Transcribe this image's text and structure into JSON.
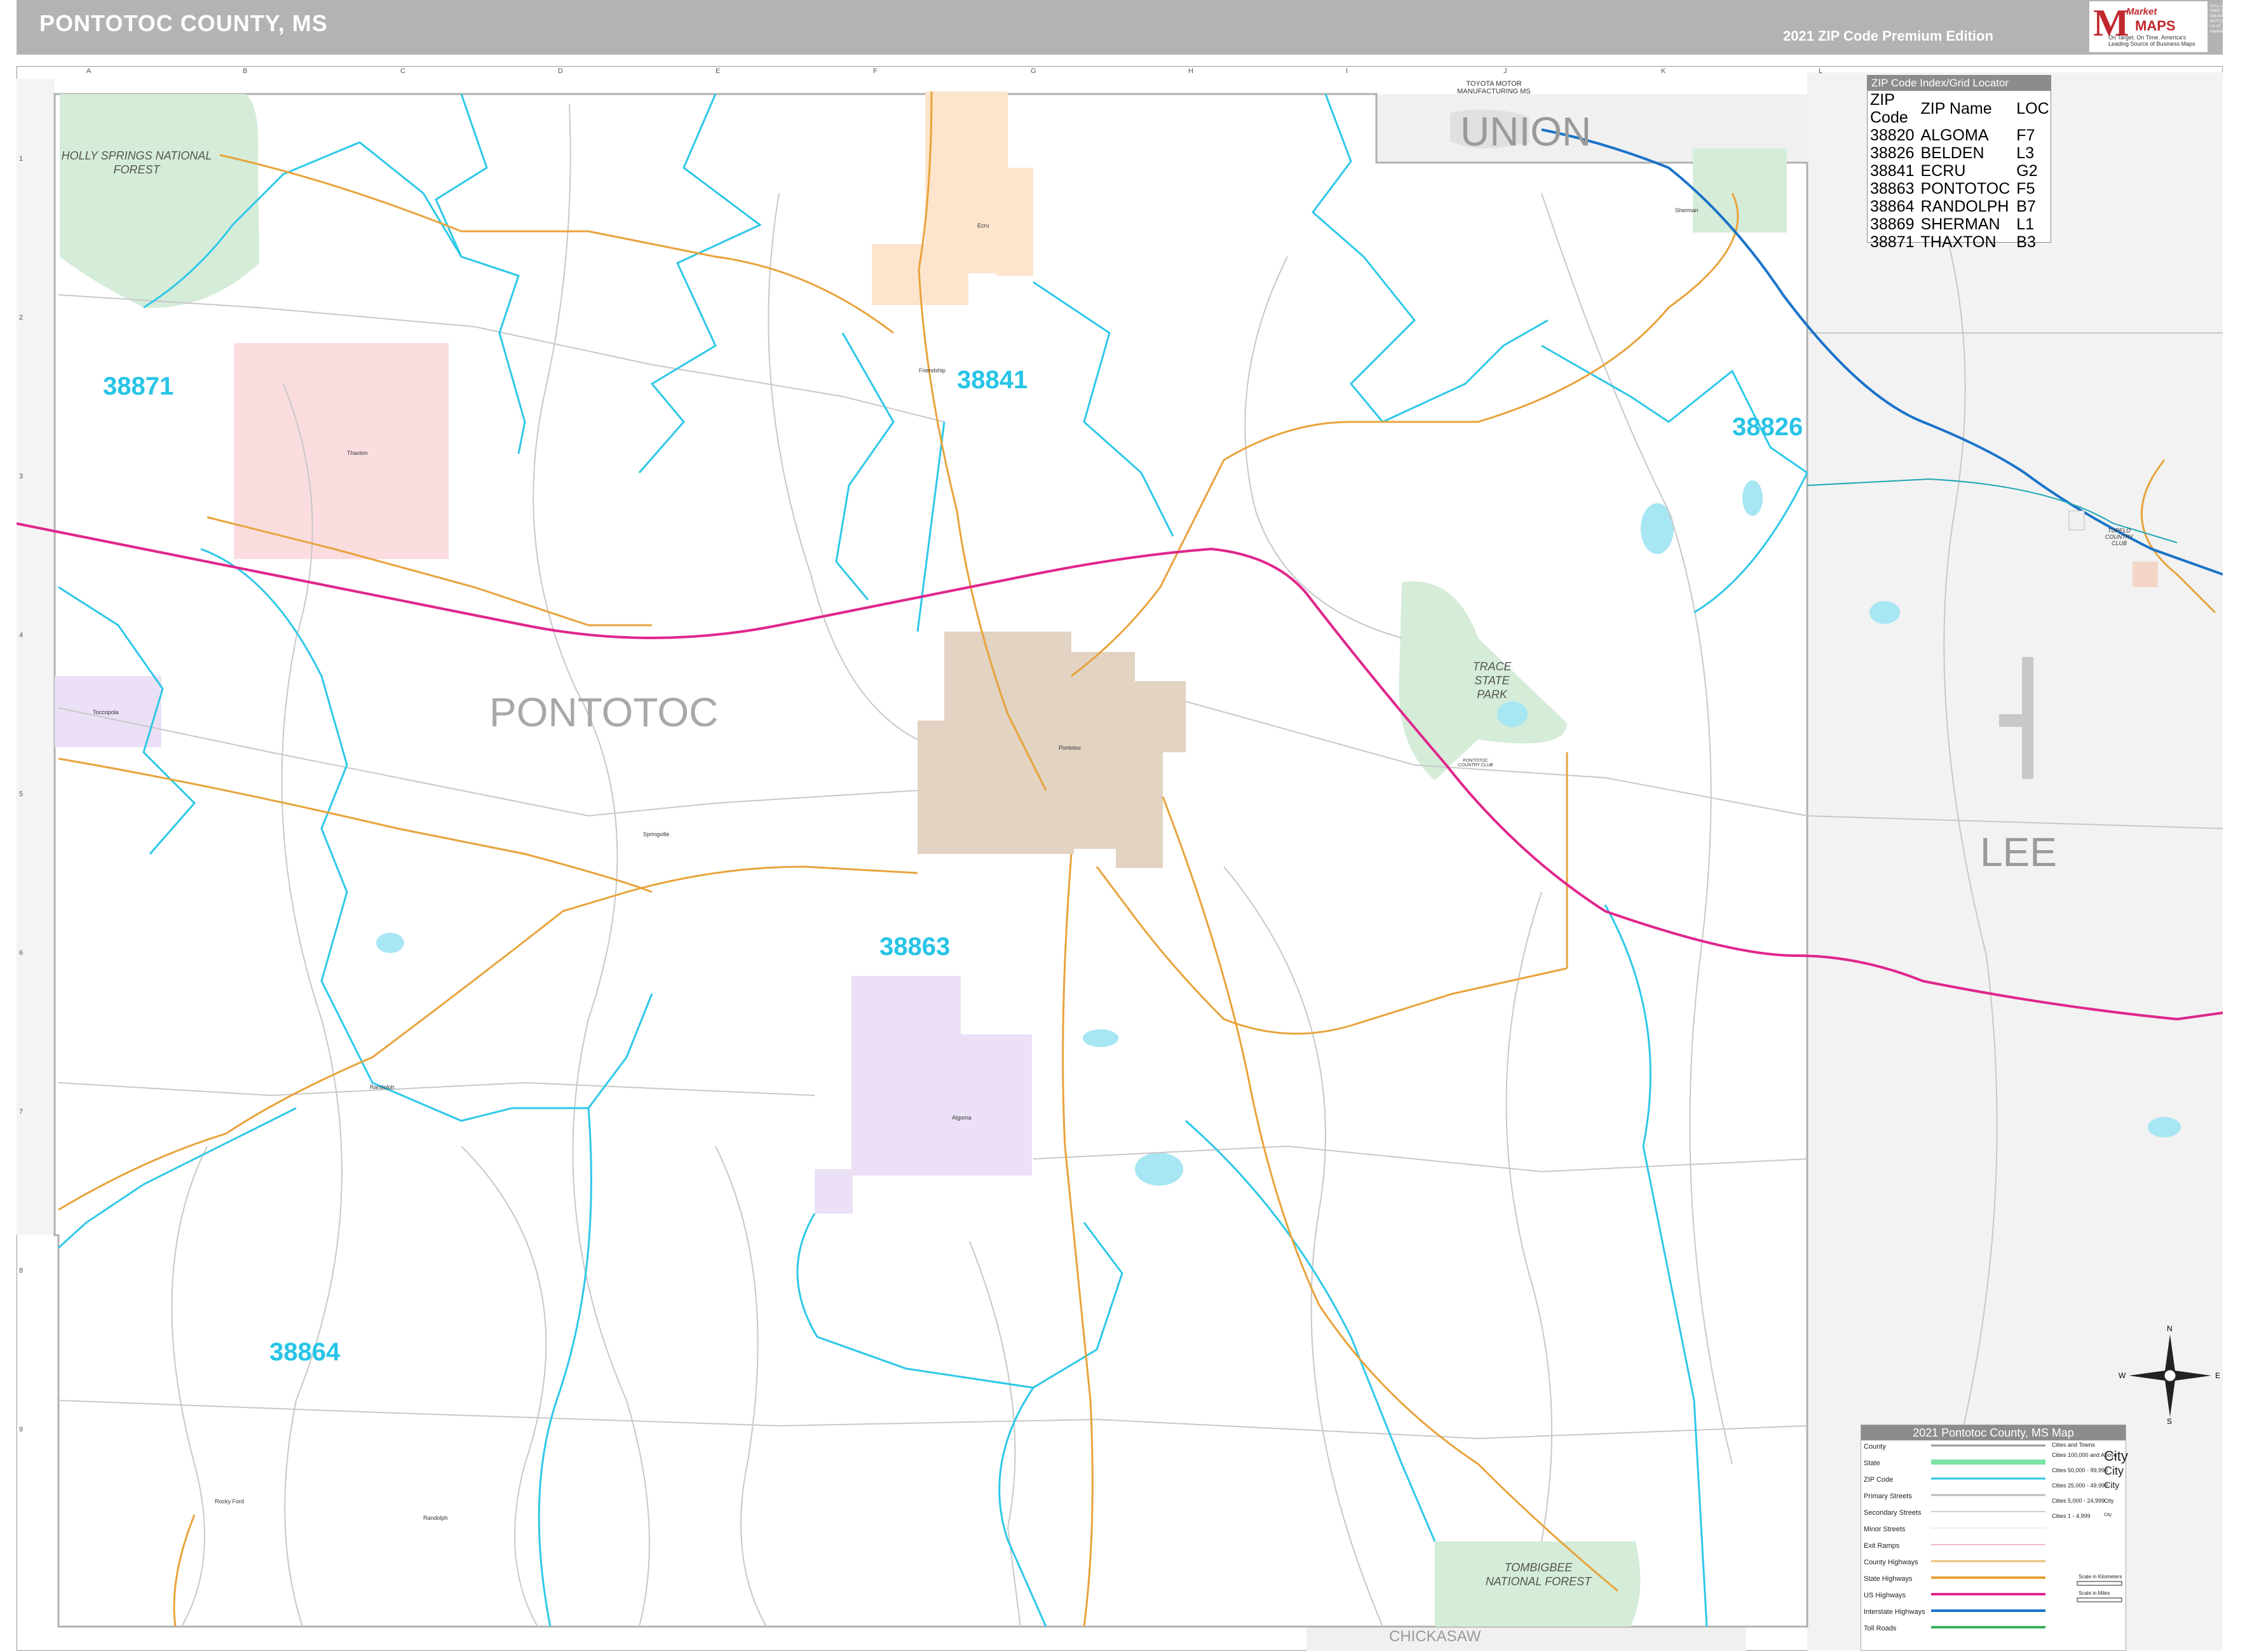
{
  "header": {
    "title": "PONTOTOC COUNTY, MS",
    "edition": "2021 ZIP Code Premium Edition",
    "brand_market": "Market",
    "brand_maps": "MAPS",
    "brand_tagline": "On Target. On Time. America's Leading Source of Business Maps",
    "contact": "CALL US TOLL FREE 1-800-334-MAPS (6277) EMAIL US AT mapsales@marketmaps.com"
  },
  "map": {
    "county_name": "PONTOTOC",
    "neighbors": {
      "north": "UNION",
      "east": "LEE",
      "south": "CHICKASAW"
    },
    "places": {
      "forest_north": "HOLLY SPRINGS NATIONAL FOREST",
      "forest_south": "TOMBIGBEE NATIONAL FOREST",
      "park": "TRACE STATE PARK",
      "toyota": "TOYOTA MOTOR MANUFACTURING MS",
      "tupelo_club": "TUPELO COUNTRY CLUB",
      "pontotoc_club": "PONTOTOC COUNTRY CLUB"
    },
    "zip_labels": [
      {
        "zip": "38871"
      },
      {
        "zip": "38841"
      },
      {
        "zip": "38826"
      },
      {
        "zip": "38863"
      },
      {
        "zip": "38864"
      }
    ],
    "towns": [
      "Ecru",
      "Thaxton",
      "Pontotoc",
      "Algoma",
      "Randolph",
      "Sherman",
      "Toccopola",
      "Springville",
      "Randolph",
      "Friendship",
      "Rocky Ford"
    ],
    "grid_cols": [
      "A",
      "B",
      "C",
      "D",
      "E",
      "F",
      "G",
      "H",
      "I",
      "J",
      "K",
      "L"
    ],
    "grid_rows": [
      "1",
      "2",
      "3",
      "4",
      "5",
      "6",
      "7",
      "8",
      "9"
    ],
    "colors": {
      "zip_boundary": "#2ec8e8",
      "us_highway": "#e0268c",
      "interstate": "#1a73c9",
      "state_highway": "#e8a33b",
      "primary_street": "#bdbdbd",
      "forest": "#d5ecd9",
      "neighbor_fill": "#f0f0f0"
    }
  },
  "zip_index": {
    "title": "ZIP Code Index/Grid Locator",
    "headers": [
      "ZIP Code",
      "ZIP Name",
      "LOC"
    ],
    "rows": [
      [
        "38820",
        "ALGOMA",
        "F7"
      ],
      [
        "38826",
        "BELDEN",
        "L3"
      ],
      [
        "38841",
        "ECRU",
        "G2"
      ],
      [
        "38863",
        "PONTOTOC",
        "F5"
      ],
      [
        "38864",
        "RANDOLPH",
        "B7"
      ],
      [
        "38869",
        "SHERMAN",
        "L1"
      ],
      [
        "38871",
        "THAXTON",
        "B3"
      ]
    ]
  },
  "legend": {
    "title": "2021 Pontotoc County, MS Map",
    "left_items": [
      "County",
      "State",
      "ZIP Code",
      "Primary Streets",
      "Secondary Streets",
      "Minor Streets",
      "Exit Ramps",
      "County Highways",
      "State Highways",
      "US Highways",
      "Interstate Highways",
      "Toll Roads"
    ],
    "cities_title": "Cities and Towns",
    "cities": [
      {
        "range": "Cities 100,000 and Above",
        "label": "City"
      },
      {
        "range": "Cities 50,000 - 99,999",
        "label": "City"
      },
      {
        "range": "Cities 25,000 - 49,999",
        "label": "City"
      },
      {
        "range": "Cities 5,000 - 24,999",
        "label": "City"
      },
      {
        "range": "Cities 1 - 4,999",
        "label": "City"
      }
    ],
    "scale_km": "Scale in Kilometers",
    "scale_mi": "Scale in Miles"
  },
  "compass": {
    "n": "N",
    "s": "S",
    "e": "E",
    "w": "W"
  }
}
